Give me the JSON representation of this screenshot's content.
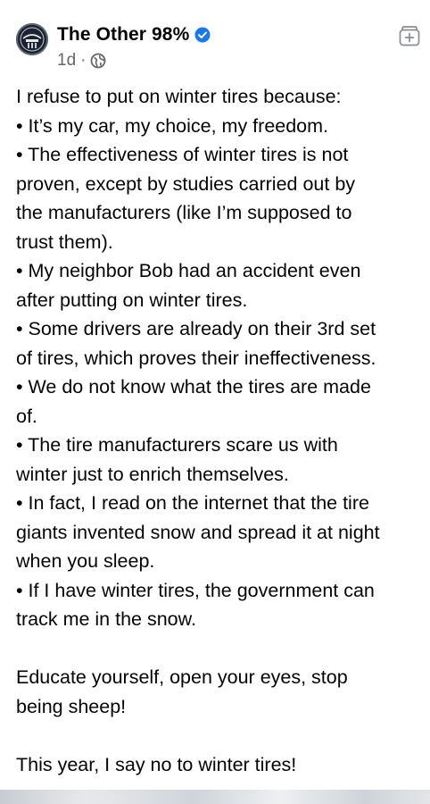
{
  "post": {
    "page_name": "The Other 98%",
    "time_ago": "1d",
    "meta_separator": "·",
    "icons": {
      "avatar": "page-avatar-logo",
      "verified": "verified-badge-icon",
      "audience": "globe-icon",
      "save": "bookmark-add-icon"
    },
    "colors": {
      "verified": "#1877f2",
      "meta_text": "#65676b",
      "name_text": "#050505"
    },
    "lines": [
      "I refuse to put on winter tires because:",
      "• It’s my car, my choice, my freedom.",
      "• The effectiveness of winter tires is not",
      "proven, except by studies carried out by",
      "the manufacturers (like I’m supposed to",
      "trust them).",
      "• My neighbor Bob had an accident even",
      "after putting on winter tires.",
      "• Some drivers are already on their 3rd set",
      "of tires, which proves their ineffectiveness.",
      "• We do not know what the tires are made",
      "of.",
      "• The tire manufacturers scare us with",
      "winter just to enrich themselves.",
      "• In fact, I read on the internet that the tire",
      "giants invented snow and spread it at night",
      "when you sleep.",
      "• If I have winter tires, the government can",
      "track me in the snow.",
      "",
      "Educate yourself, open your eyes, stop",
      "being sheep!",
      "",
      "This year, I say no to winter tires!"
    ]
  }
}
